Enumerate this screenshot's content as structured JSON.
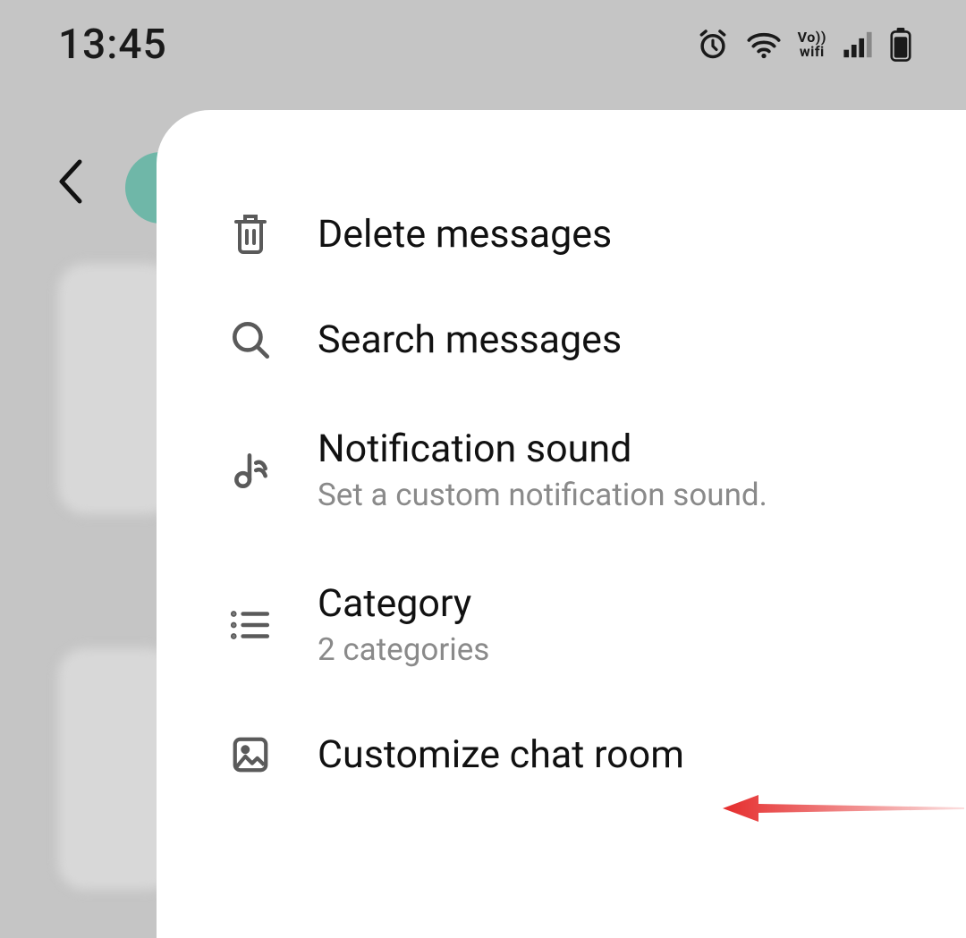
{
  "status_bar": {
    "time": "13:45",
    "vowifi_top": "Vo))",
    "vowifi_bottom": "wifi"
  },
  "menu": {
    "delete": {
      "label": "Delete messages"
    },
    "search": {
      "label": "Search messages"
    },
    "notification": {
      "label": "Notification sound",
      "sub": "Set a custom notification sound."
    },
    "category": {
      "label": "Category",
      "sub": "2 categories"
    },
    "customize": {
      "label": "Customize chat room"
    }
  }
}
